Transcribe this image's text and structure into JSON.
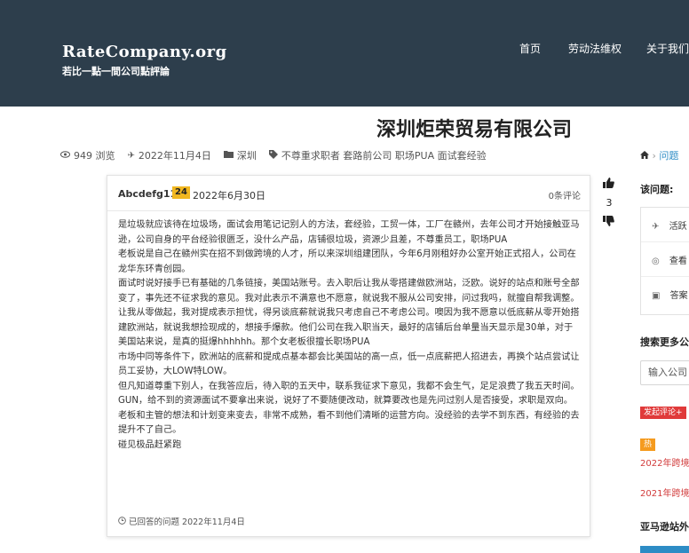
{
  "header": {
    "logo_main": "RateCompany.org",
    "logo_sub": "若比一點一間公司點評論",
    "nav": [
      "首页",
      "劳动法维权",
      "关于我们"
    ]
  },
  "question": {
    "title": "深圳炬荣贸易有限公司",
    "views": "949 浏览",
    "date": "2022年11月4日",
    "city": "深圳",
    "tags": "不尊重求职者 套路前公司 职场PUA 面试套经验"
  },
  "answer": {
    "author": "Abcdefg111",
    "badge": "24",
    "date": "2022年6月30日",
    "comments": "0条评论",
    "votes": "3",
    "paragraphs": [
      "是垃圾就应该待在垃圾场，面试会用笔记记别人的方法，套经验，工贸一体，工厂在赣州，去年公司才开始接触亚马逊，公司自身的平台经验很匮乏，没什么产品，店铺很垃圾，资源少且差，不尊重员工，职场PUA",
      "老板说是自己在赣州实在招不到做跨境的人才，所以来深圳组建团队，今年6月刚租好办公室开始正式招人，公司在龙华东环青创园。",
      "面试时说好接手已有基础的几条链接，美国站账号。去入职后让我从零搭建做欧洲站，泛欧。说好的站点和账号全部变了，事先还不征求我的意见。我对此表示不满意也不愿意，就说我不服从公司安排，问过我吗，就擅自帮我调整。让我从零做起，我对提成表示担忧，得另谈底薪就说我只考虑自己不考虑公司。噢因为我不愿意以低底薪从零开始搭建欧洲站，就说我想捡现成的，想接手爆款。他们公司在我入职当天，最好的店铺后台单量当天显示是30单，对于美国站来说，是真的挺爆hhhhhh。那个女老板很擅长职场PUA",
      "市场中同等条件下，欧洲站的底薪和提成点基本都会比美国站的高一点，低一点底薪把人招进去，再换个站点尝试让员工妥协，大LOW特LOW。",
      "但凡知道尊重下别人，在我答应后，待入职的五天中，联系我征求下意见，我都不会生气，足足浪费了我五天时间。GUN，给不到的资源面试不要拿出来说，说好了不要随便改动，就算要改也是先问过别人是否接受，求职是双向。老板和主管的想法和计划变来变去，非常不成熟，看不到他们清晰的运营方向。没经验的去学不到东西，有经验的去提升不了自己。",
      "碰见极品赶紧跑"
    ],
    "footer": "已回答的问题 2022年11月4日"
  },
  "sidebar": {
    "crumb_home": "问题",
    "heading1": "该问题:",
    "stats": [
      "活跃",
      "查看",
      "答案"
    ],
    "heading2": "搜索更多公",
    "search_placeholder": "输入公司",
    "tag_red": "发起评论+",
    "tag_hot": "热",
    "links": [
      "2022年跨境",
      "2021年跨境"
    ],
    "heading3": "亚马逊站外"
  },
  "icons": {
    "eye": "eye-icon",
    "plane": "plane-icon",
    "folder": "folder-icon",
    "tag": "tag-icon",
    "home": "home-icon",
    "thumb_up": "thumbs-up-icon",
    "thumb_down": "thumbs-down-icon",
    "clock": "clock-icon"
  },
  "colors": {
    "header_bg": "#2d3e4c",
    "badge": "#f1b720",
    "link": "#2d8cc5",
    "red_tag": "#e03a3a",
    "hot_tag": "#f59b1f"
  }
}
